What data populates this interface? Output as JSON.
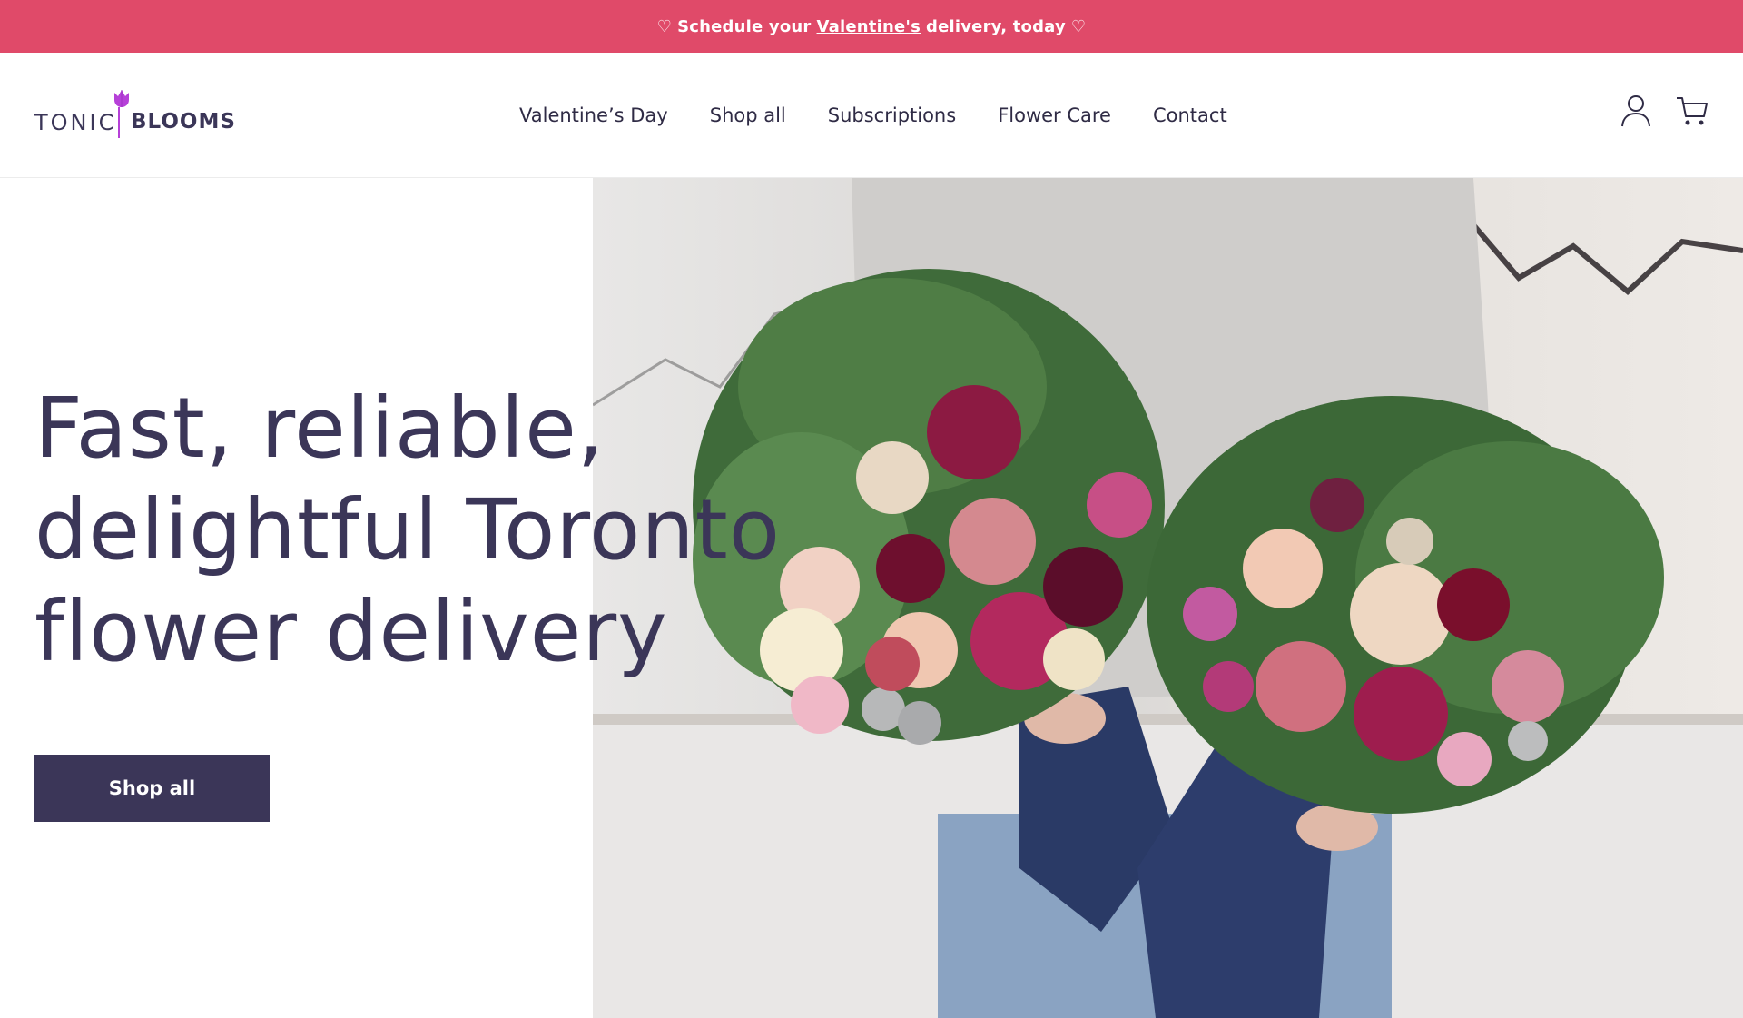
{
  "announcement": {
    "heart": "♡",
    "prefix": "Schedule your",
    "link": "Valentine's",
    "suffix": "delivery, today"
  },
  "logo": {
    "part1": "TONIC",
    "part2": "BLOOMS"
  },
  "nav": {
    "items": [
      {
        "label": "Valentine’s Day"
      },
      {
        "label": "Shop all"
      },
      {
        "label": "Subscriptions"
      },
      {
        "label": "Flower Care"
      },
      {
        "label": "Contact"
      }
    ]
  },
  "header_icons": [
    "account-icon",
    "cart-icon"
  ],
  "hero": {
    "title_lines": [
      "Fast, reliable,",
      "delightful Toronto",
      "flower delivery"
    ],
    "cta_label": "Shop all",
    "image_subject": "flower-bouquets-photo"
  },
  "colors": {
    "announcement_bg": "#e04a69",
    "brand_dark": "#3b3658",
    "logo_accent": "#b640d8"
  }
}
